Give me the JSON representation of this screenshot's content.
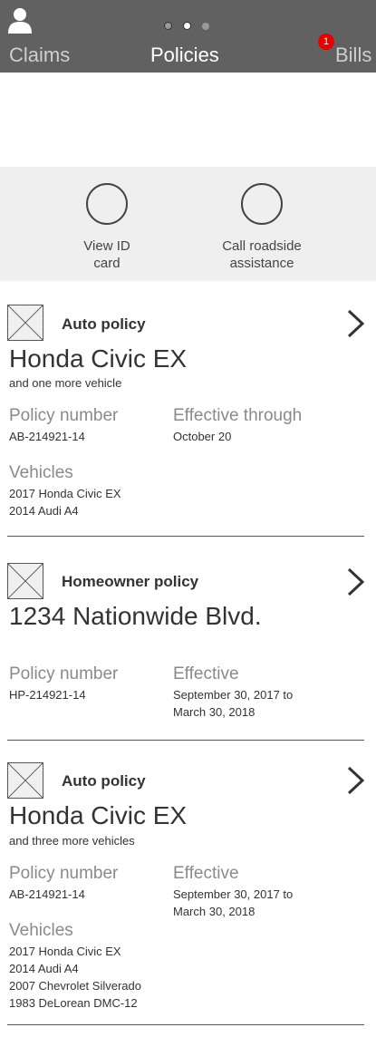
{
  "nav": {
    "tabs": [
      {
        "label": "Claims"
      },
      {
        "label": "Policies"
      },
      {
        "label": "Bills"
      }
    ],
    "bills_badge": "1",
    "page_indicator_count": "3",
    "colors": {
      "header": "#616161",
      "badge": "#e60000"
    }
  },
  "actions": [
    {
      "label": "View ID\ncard"
    },
    {
      "label": "Call roadside\nassistance"
    }
  ],
  "policies": [
    {
      "type": "Auto policy",
      "title": "Honda Civic EX",
      "subtitle": "and one more vehicle",
      "number_label": "Policy number",
      "number": "AB-214921-14",
      "effective_label": "Effective through",
      "effective": "October 20",
      "vehicles_label": "Vehicles",
      "vehicles": [
        "2017 Honda Civic EX",
        "2014 Audi A4"
      ]
    },
    {
      "type": "Homeowner policy",
      "title": "1234 Nationwide Blvd.",
      "number_label": "Policy number",
      "number": "HP-214921-14",
      "effective_label": "Effective",
      "effective": "September 30, 2017 to\nMarch 30, 2018"
    },
    {
      "type": "Auto policy",
      "title": "Honda Civic EX",
      "subtitle": "and three more vehicles",
      "number_label": "Policy number",
      "number": "AB-214921-14",
      "effective_label": "Effective",
      "effective": "September 30, 2017 to\nMarch 30, 2018",
      "vehicles_label": "Vehicles",
      "vehicles": [
        "2017 Honda Civic EX",
        "2014 Audi A4",
        "2007 Chevrolet Silverado",
        "1983 DeLorean DMC-12"
      ]
    }
  ]
}
